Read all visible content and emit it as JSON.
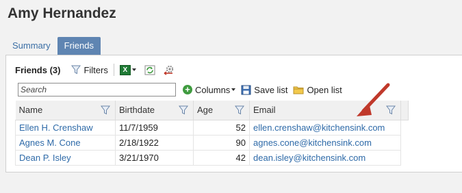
{
  "person": {
    "name": "Amy Hernandez"
  },
  "tabs": [
    {
      "label": "Summary",
      "active": false
    },
    {
      "label": "Friends",
      "active": true
    }
  ],
  "grid": {
    "title": "Friends (3)",
    "filters_label": "Filters",
    "search_placeholder": "Search",
    "columns_label": "Columns",
    "save_list_label": "Save list",
    "open_list_label": "Open list",
    "headers": [
      "Name",
      "Birthdate",
      "Age",
      "Email"
    ],
    "rows": [
      [
        "Ellen H. Crenshaw",
        "11/7/1959",
        "52",
        "ellen.crenshaw@kitchensink.com"
      ],
      [
        "Agnes M. Cone",
        "2/18/1922",
        "90",
        "agnes.cone@kitchensink.com"
      ],
      [
        "Dean P. Isley",
        "3/21/1970",
        "42",
        "dean.isley@kitchensink.com"
      ]
    ]
  },
  "icons": {
    "filter": "funnel-icon",
    "excel": "excel-icon",
    "refresh": "refresh-icon",
    "settings": "settings-icon",
    "add": "plus-icon",
    "save": "save-icon",
    "open": "folder-icon",
    "annotation": "red-arrow"
  },
  "colors": {
    "active_tab": "#5f85b2",
    "link": "#2e6aa8",
    "annotation_arrow": "#c0392b"
  }
}
